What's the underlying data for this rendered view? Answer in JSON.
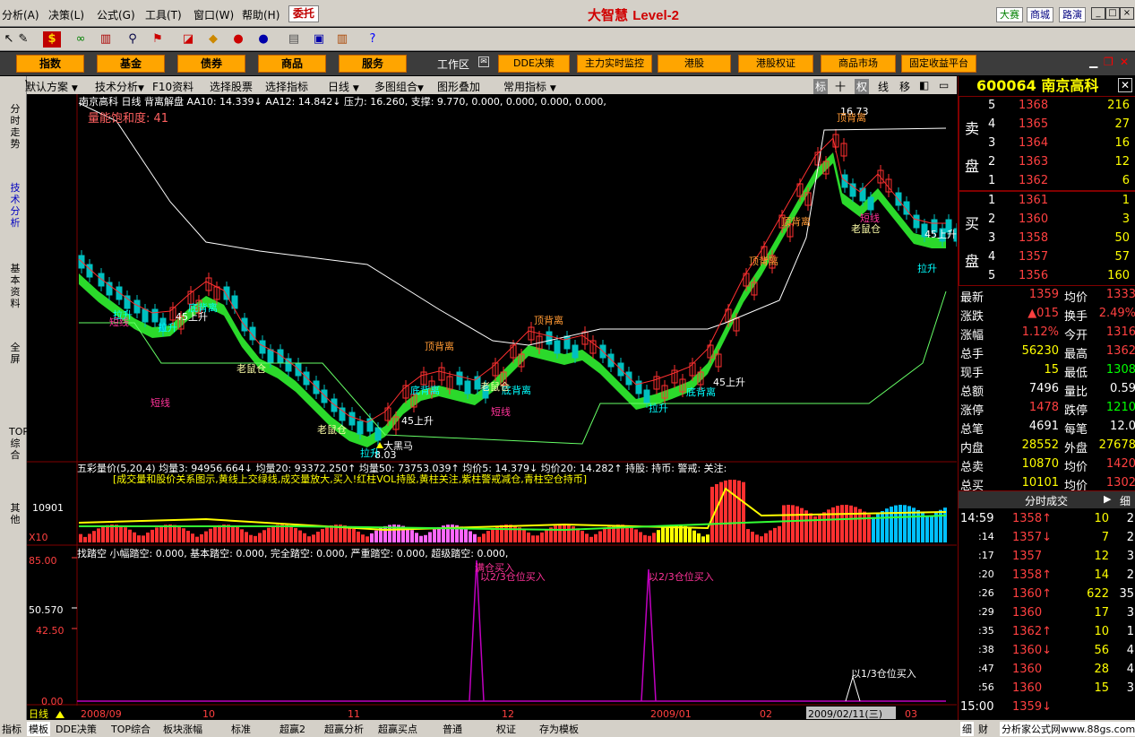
{
  "menu": {
    "items": [
      "分析(A)",
      "决策(L)",
      "公式(G)",
      "工具(T)",
      "窗口(W)",
      "帮助(H)"
    ],
    "weituo": "委托",
    "app_title": "大智慧",
    "level": "Level-2",
    "right_buttons": [
      "大赛",
      "商城",
      "路演"
    ]
  },
  "navbar": {
    "buttons": [
      "指数",
      "基金",
      "债券",
      "商品",
      "服务"
    ],
    "work_label": "工作区",
    "right_buttons": [
      "DDE决策",
      "主力实时监控",
      "港股",
      "港股权证",
      "商品市场",
      "固定收益平台"
    ]
  },
  "left_tabs": [
    "分时走势",
    "技术分析",
    "基本资料",
    "全屏",
    "TOP综合",
    "其他"
  ],
  "chart_toolbar": {
    "items": [
      "默认方案",
      "技术分析",
      "F10资料",
      "选择股票",
      "选择指标",
      "日线",
      "多图组合",
      "图形叠加",
      "常用指标"
    ],
    "right_items": [
      "标",
      "十",
      "权",
      "线",
      "移"
    ]
  },
  "main_chart": {
    "header": "南京高科 日线 背离解盘 AA10: 14.339↓ AA12: 14.842↓ 压力: 16.260, 支撑: 9.770, 0.000, 0.000, 0.000, 0.000,",
    "saturation": "量能饱和度: 41",
    "price_top": "16.73",
    "price_low": "8.03",
    "annotations": [
      "顶背离",
      "顶背离",
      "顶背离",
      "顶背离",
      "顶背离",
      "底背离",
      "底背离",
      "底背离",
      "底背离",
      "拉升",
      "拉升",
      "拉升",
      "拉升",
      "拉升",
      "短线",
      "短线",
      "短线",
      "短线",
      "45上升",
      "45上升",
      "45上升",
      "45上升",
      "老鼠仓",
      "老鼠仓",
      "老鼠仓",
      "老鼠仓",
      "大黑马"
    ]
  },
  "volume_panel": {
    "header": "五彩量价(5,20,4) 均量3: 94956.664↓ 均量20: 93372.250↑ 均量50: 73753.039↑ 均价5: 14.379↓ 均价20: 14.282↑ 持股: 持币: 警戒: 关注:",
    "desc": "[成交量和股价关系图示,黄线上交绿线,成交量放大,买入!红柱VOL持股,黄柱关注,紫柱警戒减仓,青柱空仓持币]",
    "ylabel": "10901",
    "unit": "X10"
  },
  "bottom_panel": {
    "header": "找踏空 小幅踏空: 0.000, 基本踏空: 0.000, 完全踏空: 0.000, 严重踏空: 0.000, 超级踏空: 0.000,",
    "yticks": [
      "85.00",
      "50.570",
      "42.50",
      "0.00"
    ],
    "signals": [
      "满仓买入",
      "以2/3仓位买入",
      "以2/3仓位买入",
      "以1/3仓位买入"
    ]
  },
  "xaxis": {
    "period": "日线",
    "labels": [
      "2008/09",
      "10",
      "11",
      "12",
      "2009/01",
      "02",
      "2009/02/11(三)",
      "03"
    ]
  },
  "quote": {
    "code": "600064",
    "name": "南京高科",
    "sell": [
      {
        "n": "5",
        "p": "1368",
        "v": "216"
      },
      {
        "n": "4",
        "p": "1365",
        "v": "27"
      },
      {
        "n": "3",
        "p": "1364",
        "v": "16"
      },
      {
        "n": "2",
        "p": "1363",
        "v": "12"
      },
      {
        "n": "1",
        "p": "1362",
        "v": "6"
      }
    ],
    "buy": [
      {
        "n": "1",
        "p": "1361",
        "v": "1"
      },
      {
        "n": "2",
        "p": "1360",
        "v": "3"
      },
      {
        "n": "3",
        "p": "1358",
        "v": "50"
      },
      {
        "n": "4",
        "p": "1357",
        "v": "57"
      },
      {
        "n": "5",
        "p": "1356",
        "v": "160"
      }
    ],
    "sell_label": [
      "卖",
      "盘"
    ],
    "buy_label": [
      "买",
      "盘"
    ],
    "stats": [
      [
        "最新",
        "1359",
        "均价",
        "1333"
      ],
      [
        "涨跌",
        "▲015",
        "换手",
        "2.49%"
      ],
      [
        "涨幅",
        "1.12%",
        "今开",
        "1316"
      ],
      [
        "总手",
        "56230",
        "最高",
        "1362"
      ],
      [
        "现手",
        "15",
        "最低",
        "1308"
      ],
      [
        "总额",
        "7496",
        "量比",
        "0.59"
      ],
      [
        "涨停",
        "1478",
        "跌停",
        "1210"
      ],
      [
        "总笔",
        "4691",
        "每笔",
        "12.0"
      ],
      [
        "内盘",
        "28552",
        "外盘",
        "27678"
      ],
      [
        "总卖",
        "10870",
        "均价",
        "1420"
      ],
      [
        "总买",
        "10101",
        "均价",
        "1302"
      ]
    ],
    "trades_title": "分时成交",
    "trades": [
      [
        "14:59",
        "1358↑",
        "10",
        "2"
      ],
      [
        ":14",
        "1357↓",
        "7",
        "2"
      ],
      [
        ":17",
        "1357",
        "12",
        "3"
      ],
      [
        ":20",
        "1358↑",
        "14",
        "2"
      ],
      [
        ":26",
        "1360↑",
        "622",
        "35"
      ],
      [
        ":29",
        "1360",
        "17",
        "3"
      ],
      [
        ":35",
        "1362↑",
        "10",
        "1"
      ],
      [
        ":38",
        "1360↓",
        "56",
        "4"
      ],
      [
        ":47",
        "1360",
        "28",
        "4"
      ],
      [
        ":56",
        "1360",
        "15",
        "3"
      ],
      [
        "15:00",
        "1359↓",
        "",
        ""
      ]
    ]
  },
  "statusbar": {
    "items": [
      "指标",
      "模板",
      "DDE决策",
      "TOP综合",
      "板块涨幅",
      "标准",
      "超赢2",
      "超赢分析",
      "超赢买点",
      "普通",
      "权证",
      "存为模板"
    ],
    "right": "细",
    "right2": "财",
    "site": "分析家公式网www.88gs.com"
  },
  "colors": {
    "up": "#ff3030",
    "down": "#00c0c0",
    "band_up": "#ff9900",
    "band_down": "#33ff33"
  }
}
